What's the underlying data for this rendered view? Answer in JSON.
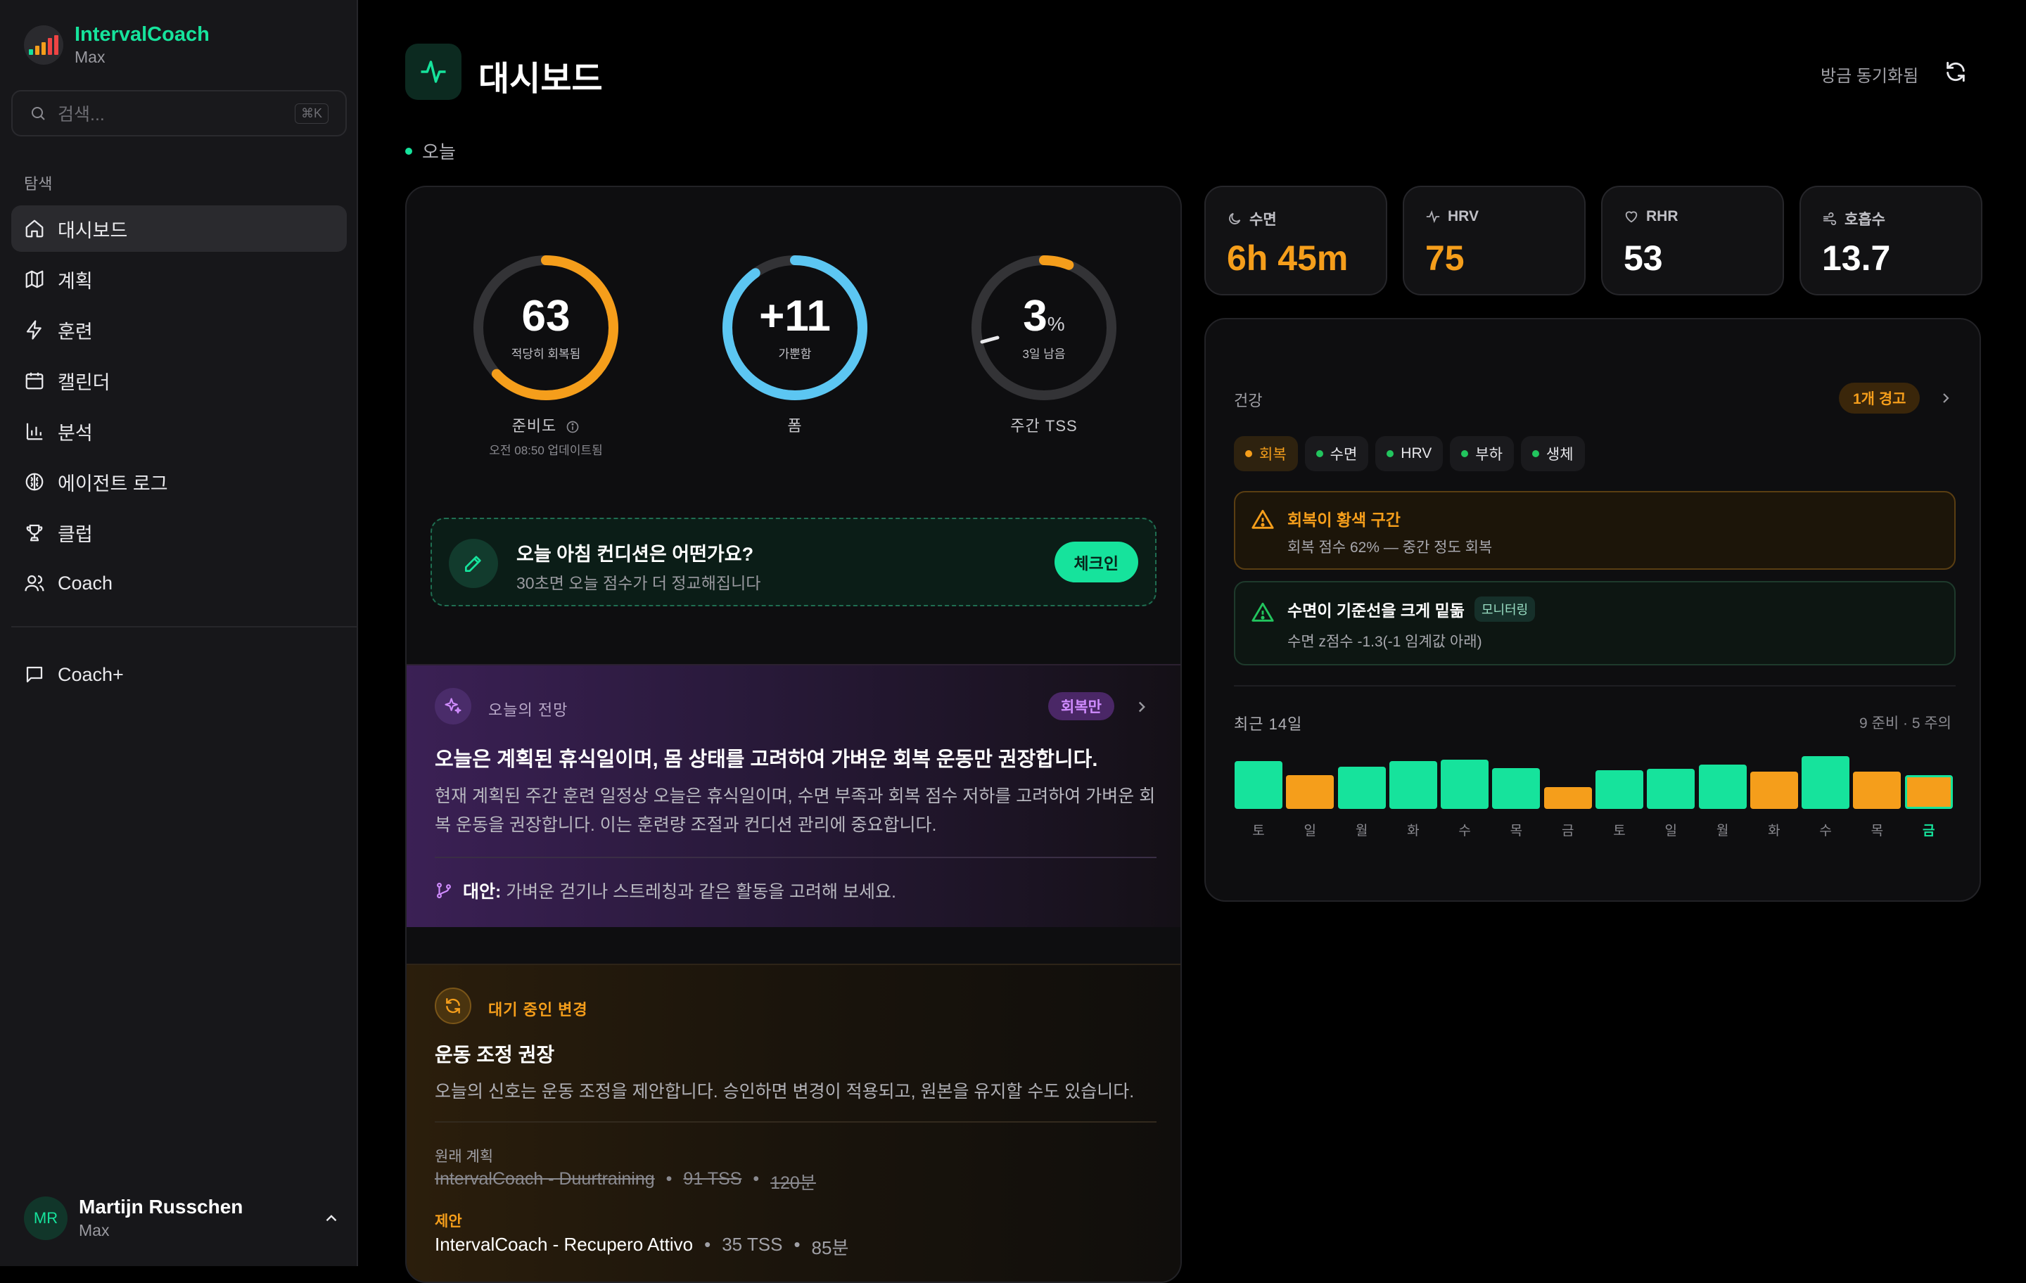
{
  "app": {
    "name": "IntervalCoach",
    "subtitle": "Max"
  },
  "colors": {
    "accent": "#16e39c",
    "warning": "#f59e1b",
    "info": "#5cc6f2",
    "purple": "#d08cff"
  },
  "search": {
    "placeholder": "검색...",
    "shortcut": "⌘K"
  },
  "sidebar": {
    "section_label": "탐색",
    "items": [
      {
        "label": "대시보드",
        "icon": "home-icon"
      },
      {
        "label": "계획",
        "icon": "map-icon"
      },
      {
        "label": "훈련",
        "icon": "lightning-icon"
      },
      {
        "label": "캘린더",
        "icon": "calendar-icon"
      },
      {
        "label": "분석",
        "icon": "bar-chart-icon"
      },
      {
        "label": "에이전트 로그",
        "icon": "brain-icon"
      },
      {
        "label": "클럽",
        "icon": "trophy-icon"
      },
      {
        "label": "Coach",
        "icon": "users-icon"
      }
    ],
    "coach_plus": "Coach+"
  },
  "user": {
    "initials": "MR",
    "name": "Martijn Russchen",
    "subtitle": "Max"
  },
  "header": {
    "title": "대시보드",
    "sync_text": "방금 동기화됨",
    "today": "오늘"
  },
  "gauges": [
    {
      "value": "63",
      "unit": "",
      "sub": "적당히 회복됨",
      "label": "준비도",
      "sub2": "오전 08:50 업데이트됨",
      "fraction": 0.63,
      "color": "#f59e1b"
    },
    {
      "value": "+11",
      "unit": "",
      "sub": "가뿐함",
      "label": "폼",
      "sub2": "",
      "fraction": 0.9,
      "color": "#5cc6f2"
    },
    {
      "value": "3",
      "unit": "%",
      "sub": "3일 남음",
      "label": "주간 TSS",
      "sub2": "",
      "fraction": 0.03,
      "color": "#f59e1b"
    }
  ],
  "checkin": {
    "title": "오늘 아침 컨디션은 어떤가요?",
    "subtitle": "30초면 오늘 점수가 더 정교해집니다",
    "button": "체크인"
  },
  "outlook": {
    "label": "오늘의 전망",
    "badge": "회복만",
    "title": "오늘은 계획된 휴식일이며, 몸 상태를 고려하여 가벼운 회복 운동만 권장합니다.",
    "body": "현재 계획된 주간 훈련 일정상 오늘은 휴식일이며, 수면 부족과 회복 점수 저하를 고려하여 가벼운 회복 운동을 권장합니다. 이는 훈련량 조절과 컨디션 관리에 중요합니다.",
    "alt_label": "대안:",
    "alt_text": "가벼운 걷기나 스트레칭과 같은 활동을 고려해 보세요."
  },
  "pending": {
    "label": "대기 중인 변경",
    "title": "운동 조정 권장",
    "body": "오늘의 신호는 운동 조정을 제안합니다. 승인하면 변경이 적용되고, 원본을 유지할 수도 있습니다.",
    "original_label": "원래 계획",
    "original": {
      "name": "IntervalCoach - Duurtraining",
      "tss": "91 TSS",
      "duration": "120분"
    },
    "proposal_label": "제안",
    "proposal": {
      "name": "IntervalCoach - Recupero Attivo",
      "tss": "35 TSS",
      "duration": "85분"
    }
  },
  "metrics": [
    {
      "label": "수면",
      "value": "6h 45m",
      "icon": "moon-icon",
      "color": "#f59e1b"
    },
    {
      "label": "HRV",
      "value": "75",
      "icon": "activity-icon",
      "color": "#f59e1b"
    },
    {
      "label": "RHR",
      "value": "53",
      "icon": "heart-icon",
      "color": "#ffffff"
    },
    {
      "label": "호흡수",
      "value": "13.7",
      "icon": "wind-icon",
      "color": "#ffffff"
    }
  ],
  "health": {
    "title": "건강",
    "warning_badge": "1개 경고",
    "tabs": [
      {
        "label": "회복",
        "dot": "#f59e1b"
      },
      {
        "label": "수면",
        "dot": "#22c55e"
      },
      {
        "label": "HRV",
        "dot": "#22c55e"
      },
      {
        "label": "부하",
        "dot": "#22c55e"
      },
      {
        "label": "생체",
        "dot": "#22c55e"
      }
    ],
    "alerts": [
      {
        "title": "회복이 황색 구간",
        "subtitle": "회복 점수 62% — 중간 정도 회복",
        "badge": ""
      },
      {
        "title": "수면이 기준선을 크게 밑돎",
        "subtitle": "수면 z점수 -1.3(-1 임계값 아래)",
        "badge": "모니터링"
      }
    ],
    "recent_label": "최근 14일",
    "recent_summary": "9 준비 · 5 주의",
    "days": [
      {
        "label": "토",
        "level": 1.0,
        "status": "ready"
      },
      {
        "label": "일",
        "level": 0.7,
        "status": "caution"
      },
      {
        "label": "월",
        "level": 0.88,
        "status": "ready"
      },
      {
        "label": "화",
        "level": 1.0,
        "status": "ready"
      },
      {
        "label": "수",
        "level": 1.03,
        "status": "ready"
      },
      {
        "label": "목",
        "level": 0.85,
        "status": "ready"
      },
      {
        "label": "금",
        "level": 0.45,
        "status": "caution"
      },
      {
        "label": "토",
        "level": 0.8,
        "status": "ready"
      },
      {
        "label": "일",
        "level": 0.83,
        "status": "ready"
      },
      {
        "label": "월",
        "level": 0.92,
        "status": "ready"
      },
      {
        "label": "화",
        "level": 0.78,
        "status": "caution"
      },
      {
        "label": "수",
        "level": 1.1,
        "status": "ready"
      },
      {
        "label": "목",
        "level": 0.77,
        "status": "caution"
      },
      {
        "label": "금",
        "level": 0.7,
        "status": "caution"
      }
    ]
  }
}
